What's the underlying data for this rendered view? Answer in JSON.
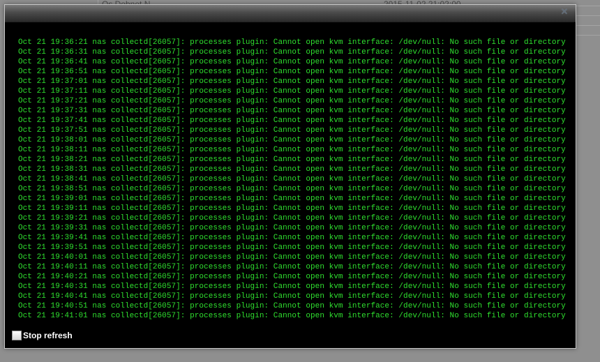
{
  "background": {
    "row_name_fragment": "Os Dobnet N",
    "row_date_fragment": "2015-11-02 21:02:00"
  },
  "dialog": {
    "close_glyph": "✕",
    "log_lines": [
      "Oct 21 19:36:21 nas collectd[26057]: processes plugin: Cannot open kvm interface: /dev/null: No such file or directory",
      "Oct 21 19:36:31 nas collectd[26057]: processes plugin: Cannot open kvm interface: /dev/null: No such file or directory",
      "Oct 21 19:36:41 nas collectd[26057]: processes plugin: Cannot open kvm interface: /dev/null: No such file or directory",
      "Oct 21 19:36:51 nas collectd[26057]: processes plugin: Cannot open kvm interface: /dev/null: No such file or directory",
      "Oct 21 19:37:01 nas collectd[26057]: processes plugin: Cannot open kvm interface: /dev/null: No such file or directory",
      "Oct 21 19:37:11 nas collectd[26057]: processes plugin: Cannot open kvm interface: /dev/null: No such file or directory",
      "Oct 21 19:37:21 nas collectd[26057]: processes plugin: Cannot open kvm interface: /dev/null: No such file or directory",
      "Oct 21 19:37:31 nas collectd[26057]: processes plugin: Cannot open kvm interface: /dev/null: No such file or directory",
      "Oct 21 19:37:41 nas collectd[26057]: processes plugin: Cannot open kvm interface: /dev/null: No such file or directory",
      "Oct 21 19:37:51 nas collectd[26057]: processes plugin: Cannot open kvm interface: /dev/null: No such file or directory",
      "Oct 21 19:38:01 nas collectd[26057]: processes plugin: Cannot open kvm interface: /dev/null: No such file or directory",
      "Oct 21 19:38:11 nas collectd[26057]: processes plugin: Cannot open kvm interface: /dev/null: No such file or directory",
      "Oct 21 19:38:21 nas collectd[26057]: processes plugin: Cannot open kvm interface: /dev/null: No such file or directory",
      "Oct 21 19:38:31 nas collectd[26057]: processes plugin: Cannot open kvm interface: /dev/null: No such file or directory",
      "Oct 21 19:38:41 nas collectd[26057]: processes plugin: Cannot open kvm interface: /dev/null: No such file or directory",
      "Oct 21 19:38:51 nas collectd[26057]: processes plugin: Cannot open kvm interface: /dev/null: No such file or directory",
      "Oct 21 19:39:01 nas collectd[26057]: processes plugin: Cannot open kvm interface: /dev/null: No such file or directory",
      "Oct 21 19:39:11 nas collectd[26057]: processes plugin: Cannot open kvm interface: /dev/null: No such file or directory",
      "Oct 21 19:39:21 nas collectd[26057]: processes plugin: Cannot open kvm interface: /dev/null: No such file or directory",
      "Oct 21 19:39:31 nas collectd[26057]: processes plugin: Cannot open kvm interface: /dev/null: No such file or directory",
      "Oct 21 19:39:41 nas collectd[26057]: processes plugin: Cannot open kvm interface: /dev/null: No such file or directory",
      "Oct 21 19:39:51 nas collectd[26057]: processes plugin: Cannot open kvm interface: /dev/null: No such file or directory",
      "Oct 21 19:40:01 nas collectd[26057]: processes plugin: Cannot open kvm interface: /dev/null: No such file or directory",
      "Oct 21 19:40:11 nas collectd[26057]: processes plugin: Cannot open kvm interface: /dev/null: No such file or directory",
      "Oct 21 19:40:21 nas collectd[26057]: processes plugin: Cannot open kvm interface: /dev/null: No such file or directory",
      "Oct 21 19:40:31 nas collectd[26057]: processes plugin: Cannot open kvm interface: /dev/null: No such file or directory",
      "Oct 21 19:40:41 nas collectd[26057]: processes plugin: Cannot open kvm interface: /dev/null: No such file or directory",
      "Oct 21 19:40:51 nas collectd[26057]: processes plugin: Cannot open kvm interface: /dev/null: No such file or directory",
      "Oct 21 19:41:01 nas collectd[26057]: processes plugin: Cannot open kvm interface: /dev/null: No such file or directory"
    ],
    "stop_refresh_label": "Stop refresh",
    "stop_refresh_checked": false
  },
  "colors": {
    "log_text": "#2fe02f",
    "dialog_bg": "#000000",
    "overlay": "#8f8f8f"
  }
}
